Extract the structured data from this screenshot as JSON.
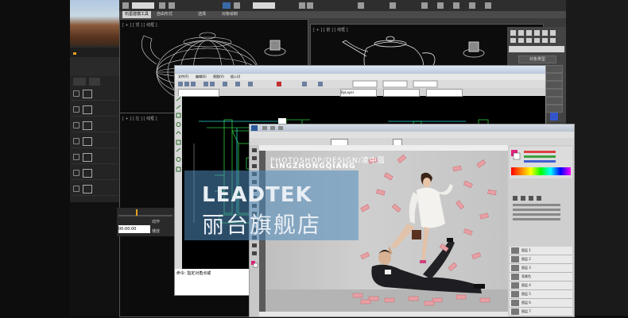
{
  "max": {
    "tabs": [
      "石墨建模工具",
      "自由形式",
      "选择",
      "对象绘制"
    ],
    "active_tab_index": 0,
    "viewport_top_left": "[ + ] [ 顶 ] [ 线框 ]",
    "viewport_top_right": "[ + ] [ 前 ] [ 线框 ]",
    "viewport_bottom_left": "[ + ] [ 左 ] [ 线框 ]",
    "cmd_panel_title": "对象类型",
    "cmd_buttons": [
      "",
      "",
      "",
      "",
      "",
      "",
      "",
      ""
    ]
  },
  "autocad": {
    "menu": [
      "文件(F)",
      "编辑(E)",
      "视图(V)",
      "插入(I)",
      "格式(O)",
      "工具(T)",
      "绘图(D)",
      "标注(N)",
      "修改(M)",
      "窗口(W)",
      "帮助(H)"
    ],
    "layer_field": "ByLayer",
    "cmd_line": "命令: 指定对角点或"
  },
  "photoshop": {
    "text_line1": "PHOTOSHOP/DESIGN/凌中强",
    "text_line2": "LINGZHONGQIANG",
    "layers": [
      "图层 1",
      "图层 2",
      "图层 3",
      "背景色",
      "图层 4",
      "图层 5",
      "图层 6",
      "图层 7",
      "背景"
    ]
  },
  "watermark": {
    "logo": "LEADTEK",
    "text": "丽台旗舰店"
  },
  "timecode": {
    "field": "00:00:00",
    "label1": "动作",
    "label2": "播放"
  },
  "colors": {
    "accent_orange": "#e8a020",
    "watermark_blue": "#508cbe",
    "cad_green": "#2ecc40"
  }
}
